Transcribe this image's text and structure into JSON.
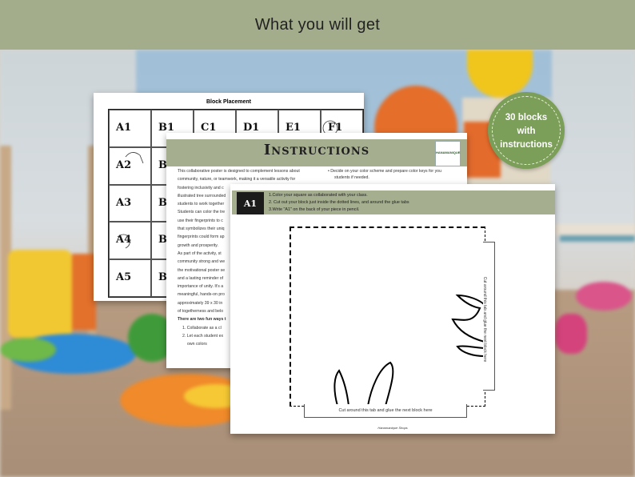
{
  "banner": {
    "title": "What you will get"
  },
  "badge": {
    "line1": "30 blocks",
    "line2": "with",
    "line3": "instructions"
  },
  "placement_sheet": {
    "title": "Block Placement",
    "visible_labels": [
      "A1",
      "B1",
      "C1",
      "D1",
      "E1",
      "F1",
      "A2",
      "B2",
      "A3",
      "B3",
      "A4",
      "B4",
      "A5",
      "B5"
    ]
  },
  "instructions_sheet": {
    "title": "Instructions",
    "logo_text": "HANAMANIQUE",
    "left_column": [
      "This collaborative poster is designed to complement lessons about",
      "community, nature, or teamwork, making it a versatile activity for",
      "fostering inclusivity and c",
      "illustrated tree surrounded",
      "students to work together",
      "Students can color the tre",
      "use their fingerprints to c",
      "that symbolizes their uniq",
      "fingerprints could form ap",
      "growth and prosperity.",
      "As part of the activity, st",
      "community strong and we",
      "the motivational poster se",
      "and a lasting reminder of",
      "importance of unity. It's a",
      "meaningful, hands-on pro",
      "approximately 39 x 30 in",
      "of togetherness and belo"
    ],
    "ways_heading": "There are two fun ways t",
    "ways": [
      "1. Collaborate as a cl",
      "2. Let each student ex",
      "own colors"
    ],
    "right_column": [
      "•  Decide on your color scheme and prepare color keys for you",
      "students if needed."
    ]
  },
  "block_sheet": {
    "badge": "A1",
    "steps": [
      "1.Color your square as collaborated with your class.",
      "2.  Cut out your block just inside the dotted lines, and around the glue tabs",
      "3.Write \"A1\" on the back of your piece in pencil."
    ],
    "tab_right": "Cut around this tab and glue the next block here",
    "tab_bottom": "Cut around this tab and glue the next block here",
    "footer": "Hanamanique Shops"
  }
}
